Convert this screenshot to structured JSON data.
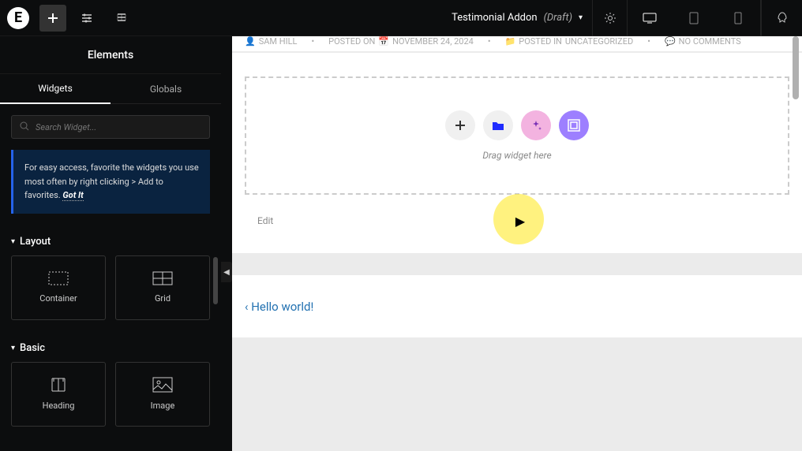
{
  "topbar": {
    "title": "Testimonial Addon",
    "status": "(Draft)"
  },
  "sidebar": {
    "title": "Elements",
    "tabs": {
      "widgets": "Widgets",
      "globals": "Globals"
    },
    "search_placeholder": "Search Widget...",
    "tip_text": "For easy access, favorite the widgets you use most often by right clicking > Add to favorites.",
    "got_it": "Got It",
    "sections": {
      "layout": {
        "title": "Layout",
        "items": [
          {
            "label": "Container"
          },
          {
            "label": "Grid"
          }
        ]
      },
      "basic": {
        "title": "Basic",
        "items": [
          {
            "label": "Heading"
          },
          {
            "label": "Image"
          }
        ]
      }
    }
  },
  "page_meta": {
    "author": "SAM HILL",
    "posted_label": "POSTED ON",
    "date_icon_prefix": "📅",
    "date": "NOVEMBER 24, 2024",
    "posted_in_label": "POSTED IN",
    "category": "UNCATEGORIZED",
    "comments": "NO COMMENTS"
  },
  "dropzone": {
    "drag_text": "Drag widget here"
  },
  "edit_label": "Edit",
  "footer_link": "‹ Hello world!"
}
